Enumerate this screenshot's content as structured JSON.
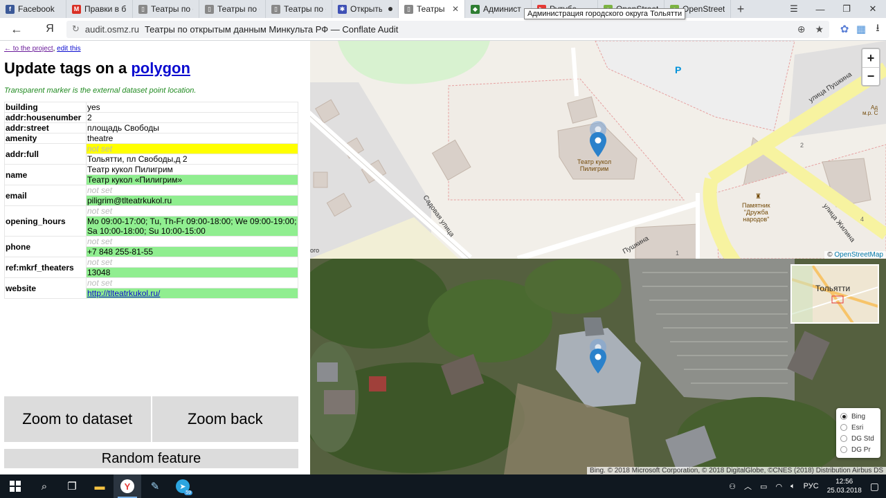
{
  "browser": {
    "tabs": [
      {
        "label": "Facebook",
        "color": "#3b5998",
        "glyph": "f"
      },
      {
        "label": "Правки в бр",
        "color": "#d93025",
        "glyph": "M"
      },
      {
        "label": "Театры по от",
        "color": "#888888",
        "glyph": "▯"
      },
      {
        "label": "Театры по от",
        "color": "#888888",
        "glyph": "▯"
      },
      {
        "label": "Театры по от",
        "color": "#888888",
        "glyph": "▯"
      },
      {
        "label": "Открытые",
        "color": "#3f51b5",
        "glyph": "✱"
      },
      {
        "label": "Театры по",
        "color": "#888888",
        "glyph": "▯"
      },
      {
        "label": "Админист",
        "color": "#2e7d32",
        "glyph": "◆"
      },
      {
        "label": "Рутубе",
        "color": "#e53935",
        "glyph": "▶"
      },
      {
        "label": "OpenStreetM",
        "color": "#7cb342",
        "glyph": "●"
      },
      {
        "label": "OpenStreetM",
        "color": "#7cb342",
        "glyph": "●"
      }
    ],
    "active_tab_index": 6,
    "tooltip": "Администрация городского округа Тольятти",
    "nav_back": "←",
    "brand": "Я",
    "url_host": "audit.osmz.ru",
    "url_title": "Театры по открытым данным Минкульта РФ — Conflate Audit"
  },
  "panel": {
    "back_link": "← to the project",
    "edit_link": "edit this",
    "title_prefix": "Update tags on a ",
    "title_link": "polygon",
    "hint": "Transparent marker is the external dataset point location.",
    "tags": [
      {
        "key": "building",
        "old": "yes"
      },
      {
        "key": "addr:housenumber",
        "old": "2"
      },
      {
        "key": "addr:street",
        "old": "площадь Свободы"
      },
      {
        "key": "amenity",
        "old": "theatre"
      },
      {
        "key": "addr:full",
        "old": "not set",
        "old_state": "yellow",
        "new": "Тольятти, пл Свободы,д 2",
        "new_state": "plain"
      },
      {
        "key": "name",
        "old": "Театр кукол Пилигрим",
        "new": "Театр кукол «Пилигрим»"
      },
      {
        "key": "email",
        "old": "not set",
        "old_state": "notset",
        "new": "piligrim@tlteatrkukol.ru"
      },
      {
        "key": "opening_hours",
        "old": "not set",
        "old_state": "notset",
        "new": "Mo 09:00-17:00; Tu, Th-Fr 09:00-18:00; We 09:00-19:00; Sa 10:00-18:00; Su 10:00-15:00"
      },
      {
        "key": "phone",
        "old": "not set",
        "old_state": "notset",
        "new": "+7 848 255-81-55"
      },
      {
        "key": "ref:mkrf_theaters",
        "old": "not set",
        "old_state": "notset",
        "new": "13048"
      },
      {
        "key": "website",
        "old": "not set",
        "old_state": "notset",
        "new": "http://tlteatrkukol.ru/",
        "new_link": true
      }
    ],
    "zoom_dataset": "Zoom to dataset",
    "zoom_back": "Zoom back",
    "random_feature": "Random feature"
  },
  "osm_map": {
    "zoom_in": "+",
    "zoom_out": "−",
    "labels": {
      "theatre": "Театр кукол\nПилигрим",
      "monument": "Памятник\n\"Дружба\nнародов\"",
      "street_pushkina": "улица Пушкина",
      "street_sadovaya": "Садовая улица",
      "street_zhilina": "улица Жилина",
      "street_pushkina2": "Пушкина",
      "parking": "P",
      "num_2": "2",
      "num_4": "4",
      "num_1": "1",
      "edge_ad": "Ад",
      "edge_mr": "м.р. С",
      "edge_go": "ого"
    },
    "attribution_prefix": "© ",
    "attribution_link": "OpenStreetMap"
  },
  "sat_map": {
    "minimap_label": "Тольятти",
    "layers": [
      {
        "label": "Bing",
        "selected": true
      },
      {
        "label": "Esri",
        "selected": false
      },
      {
        "label": "DG Std",
        "selected": false
      },
      {
        "label": "DG Pr",
        "selected": false
      }
    ],
    "attribution": "Bing. © 2018 Microsoft Corporation, © 2018 DigitalGlobe, ©CNES (2018) Distribution Airbus DS"
  },
  "taskbar": {
    "badge": "59",
    "lang": "РУС",
    "time": "12:56",
    "date": "25.03.2018"
  }
}
